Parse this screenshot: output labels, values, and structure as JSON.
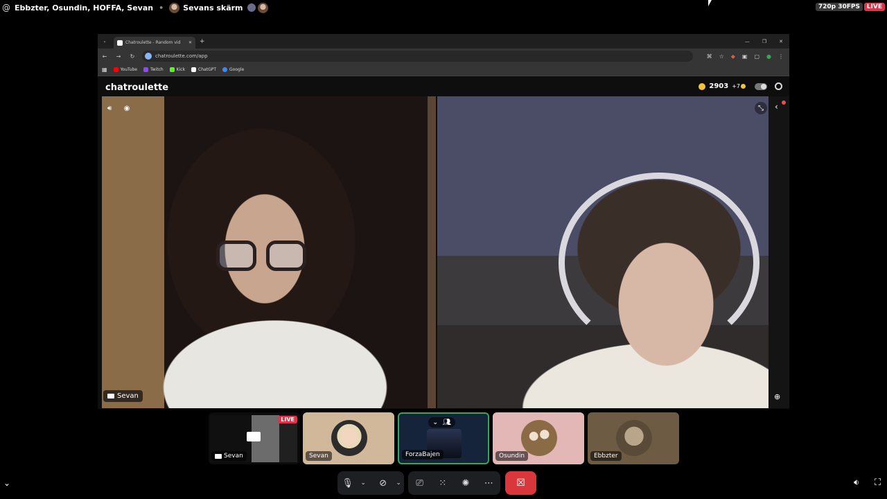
{
  "topbar": {
    "at_icon": "@",
    "participants": "Ebbzter, Osundin, HOFFA, Sevan",
    "separator": "•",
    "screen_label": "Sevans skärm",
    "quality": "720p 30FPS",
    "live": "LIVE"
  },
  "browser": {
    "tab_title": "Chatroulette - Random vid",
    "tab_close": "✕",
    "new_tab": "+",
    "url": "chatroulette.com/app",
    "bookmarks": [
      {
        "label": "YouTube",
        "color": "#ff0000"
      },
      {
        "label": "Twitch",
        "color": "#9146ff"
      },
      {
        "label": "Kick",
        "color": "#53fc18"
      },
      {
        "label": "ChatGPT",
        "color": "#ffffff"
      },
      {
        "label": "Google",
        "color": "#4285f4"
      }
    ]
  },
  "chatroulette": {
    "logo": "chatroulette",
    "coins": "2903",
    "bonus": "+7",
    "left_name": "Sevan"
  },
  "tiles": [
    {
      "name": "Sevan",
      "live": "LIVE"
    },
    {
      "name": "Sevan"
    },
    {
      "name": "ForzaBajen"
    },
    {
      "name": "Osundin"
    },
    {
      "name": "Ebbzter"
    }
  ],
  "colors": {
    "live_red": "#e0334a",
    "leave_red": "#da373c",
    "speaking_green": "#3ba55c",
    "coin_gold": "#f3c23a"
  }
}
